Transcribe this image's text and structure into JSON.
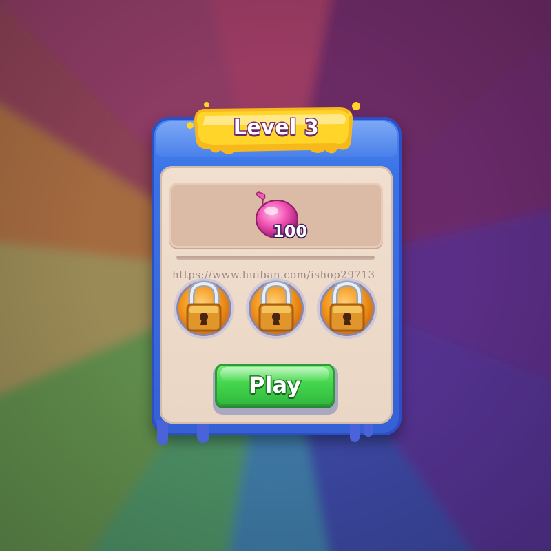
{
  "level_panel": {
    "title": "Level 3",
    "reward": {
      "icon": "balloon-icon",
      "amount": "100"
    },
    "watermark": "https://www.huiban.com/ishop29713",
    "locks": [
      {
        "icon": "padlock-icon",
        "locked": true
      },
      {
        "icon": "padlock-icon",
        "locked": true
      },
      {
        "icon": "padlock-icon",
        "locked": true
      }
    ],
    "play_label": "Play"
  },
  "colors": {
    "panel_blue": "#3a73e6",
    "banner_yellow": "#ffd52a",
    "play_green": "#45d64e",
    "inner_cream": "#eedccc"
  }
}
